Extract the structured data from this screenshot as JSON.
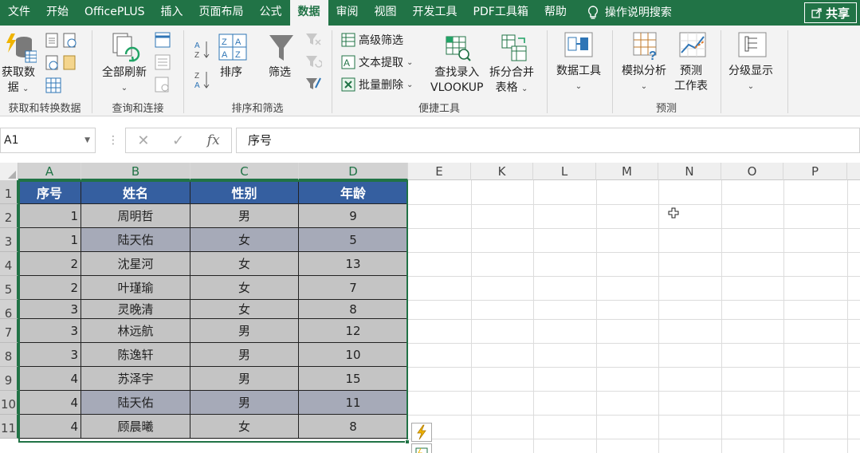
{
  "tabs": [
    "文件",
    "开始",
    "OfficePLUS",
    "插入",
    "页面布局",
    "公式",
    "数据",
    "审阅",
    "视图",
    "开发工具",
    "PDF工具箱",
    "帮助"
  ],
  "active_tab": "数据",
  "tell_me": "操作说明搜索",
  "share": "共享",
  "ribbon": {
    "get_data_1": "获取数",
    "get_data_2": "据",
    "group_get": "获取和转换数据",
    "refresh_all": "全部刷新",
    "group_query": "查询和连接",
    "sort": "排序",
    "filter": "筛选",
    "group_sort": "排序和筛选",
    "advanced_filter": "高级筛选",
    "text_extract": "文本提取",
    "batch_delete": "批量删除",
    "find_entry_1": "查找录入",
    "find_entry_2": "VLOOKUP",
    "split_merge_1": "拆分合并",
    "split_merge_2": "表格",
    "group_tools": "便捷工具",
    "data_tools": "数据工具",
    "whatif": "模拟分析",
    "forecast_1": "预测",
    "forecast_2": "工作表",
    "group_forecast": "预测",
    "outline": "分级显示"
  },
  "formula_bar": {
    "name_box": "A1",
    "cancel": "✕",
    "enter": "✓",
    "fx": "fx",
    "content": "序号"
  },
  "columns": [
    "A",
    "B",
    "C",
    "D",
    "E",
    "K",
    "L",
    "M",
    "N",
    "O",
    "P"
  ],
  "rows": [
    "1",
    "2",
    "3",
    "4",
    "5",
    "6",
    "7",
    "8",
    "9",
    "10",
    "11"
  ],
  "table": {
    "headers": [
      "序号",
      "姓名",
      "性别",
      "年龄"
    ],
    "data": [
      [
        "1",
        "周明哲",
        "男",
        "9"
      ],
      [
        "1",
        "陆天佑",
        "女",
        "5"
      ],
      [
        "2",
        "沈星河",
        "女",
        "13"
      ],
      [
        "2",
        "叶瑾瑜",
        "女",
        "7"
      ],
      [
        "3",
        "灵晚清",
        "女",
        "8"
      ],
      [
        "3",
        "林远航",
        "男",
        "12"
      ],
      [
        "3",
        "陈逸轩",
        "男",
        "10"
      ],
      [
        "4",
        "苏泽宇",
        "男",
        "15"
      ],
      [
        "4",
        "陆天佑",
        "男",
        "11"
      ],
      [
        "4",
        "顾晨曦",
        "女",
        "8"
      ]
    ],
    "highlighted_rows": [
      1,
      8
    ]
  },
  "colors": {
    "excel_green": "#217346",
    "header_blue": "#355fa0",
    "cell_grey": "#c4c4c4",
    "cell_highlight": "#a6aab8"
  }
}
